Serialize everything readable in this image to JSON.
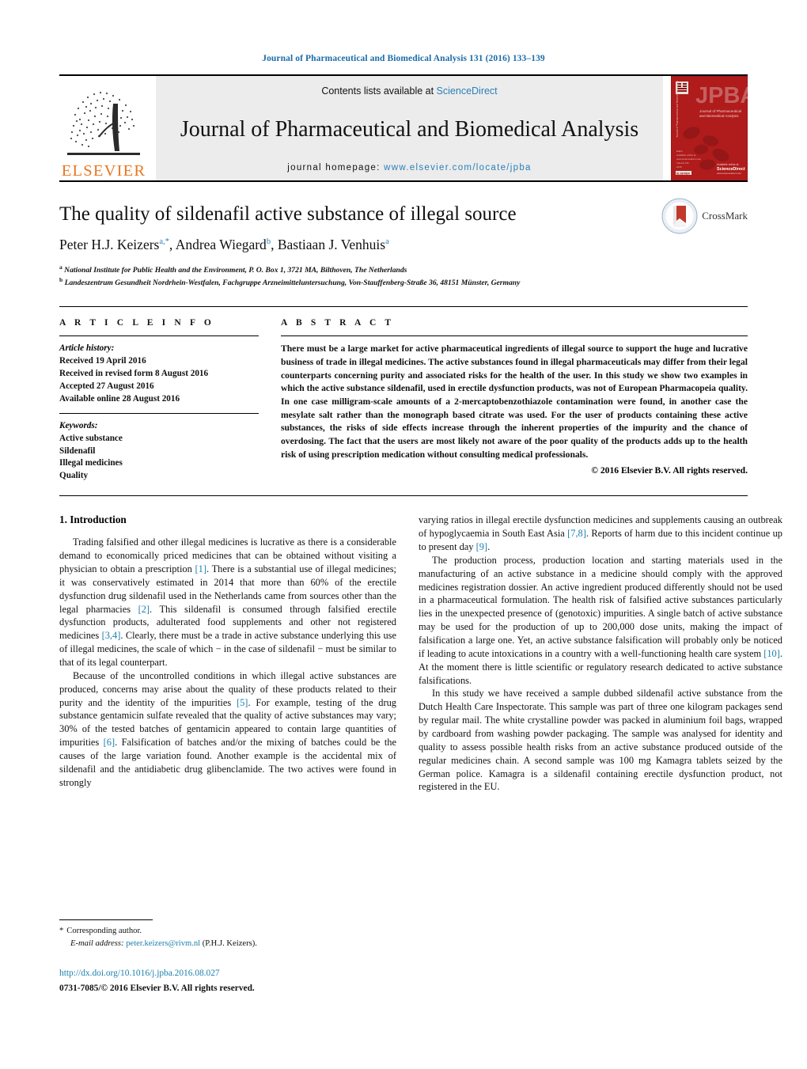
{
  "running_head": "Journal of Pharmaceutical and Biomedical Analysis 131 (2016) 133–139",
  "masthead": {
    "publisher_name": "ELSEVIER",
    "contents_prefix": "Contents lists available at ",
    "contents_link": "ScienceDirect",
    "journal_title": "Journal of Pharmaceutical and Biomedical Analysis",
    "homepage_prefix": "journal homepage: ",
    "homepage_url": "www.elsevier.com/locate/jpba",
    "cover": {
      "acronym": "JPBA",
      "subtitle_1": "Journal of Pharmaceutical",
      "subtitle_2": "and Biomedical Analysis",
      "footer_brand": "ScienceDirect"
    }
  },
  "article": {
    "title": "The quality of sildenafil active substance of illegal source",
    "authors": [
      {
        "name": "Peter H.J. Keizers",
        "marks": "a,*"
      },
      {
        "name": "Andrea Wiegard",
        "marks": "b"
      },
      {
        "name": "Bastiaan J. Venhuis",
        "marks": "a"
      }
    ],
    "authors_line": "Peter H.J. Keizers",
    "affiliations": [
      {
        "mark": "a",
        "text": "National Institute for Public Health and the Environment, P. O. Box 1, 3721 MA, Bilthoven, The Netherlands"
      },
      {
        "mark": "b",
        "text": "Landeszentrum Gesundheit Nordrhein-Westfalen, Fachgruppe Arzneimitteluntersuchung, Von-Stauffenberg-Straße 36, 48151 Münster, Germany"
      }
    ],
    "crossmark_label": "CrossMark"
  },
  "article_info": {
    "heading": "A R T I C L E    I N F O",
    "history_label": "Article history:",
    "history": [
      "Received 19 April 2016",
      "Received in revised form 8 August 2016",
      "Accepted 27 August 2016",
      "Available online 28 August 2016"
    ],
    "keywords_label": "Keywords:",
    "keywords": [
      "Active substance",
      "Sildenafil",
      "Illegal medicines",
      "Quality"
    ]
  },
  "abstract": {
    "heading": "A B S T R A C T",
    "body": "There must be a large market for active pharmaceutical ingredients of illegal source to support the huge and lucrative business of trade in illegal medicines. The active substances found in illegal pharmaceuticals may differ from their legal counterparts concerning purity and associated risks for the health of the user. In this study we show two examples in which the active substance sildenafil, used in erectile dysfunction products, was not of European Pharmacopeia quality. In one case milligram-scale amounts of a 2-mercaptobenzothiazole contamination were found, in another case the mesylate salt rather than the monograph based citrate was used. For the user of products containing these active substances, the risks of side effects increase through the inherent properties of the impurity and the chance of overdosing. The fact that the users are most likely not aware of the poor quality of the products adds up to the health risk of using prescription medication without consulting medical professionals.",
    "copyright": "© 2016 Elsevier B.V. All rights reserved."
  },
  "body": {
    "section_heading": "1.  Introduction",
    "left_paragraphs": [
      "Trading falsified and other illegal medicines is lucrative as there is a considerable demand to economically priced medicines that can be obtained without visiting a physician to obtain a prescription [1]. There is a substantial use of illegal medicines; it was conservatively estimated in 2014 that more than 60% of the erectile dysfunction drug sildenafil used in the Netherlands came from sources other than the legal pharmacies [2]. This sildenafil is consumed through falsified erectile dysfunction products, adulterated food supplements and other not registered medicines [3,4]. Clearly, there must be a trade in active substance underlying this use of illegal medicines, the scale of which − in the case of sildenafil − must be similar to that of its legal counterpart.",
      "Because of the uncontrolled conditions in which illegal active substances are produced, concerns may arise about the quality of these products related to their purity and the identity of the impurities [5]. For example, testing of the drug substance gentamicin sulfate revealed that the quality of active substances may vary; 30% of the tested batches of gentamicin appeared to contain large quantities of impurities [6]. Falsification of batches and/or the mixing of batches could be the causes of the large variation found. Another example is the accidental mix of sildenafil and the antidiabetic drug glibenclamide. The two actives were found in strongly"
    ],
    "right_paragraphs": [
      "varying ratios in illegal erectile dysfunction medicines and supplements causing an outbreak of hypoglycaemia in South East Asia [7,8]. Reports of harm due to this incident continue up to present day [9].",
      "The production process, production location and starting materials used in the manufacturing of an active substance in a medicine should comply with the approved medicines registration dossier. An active ingredient produced differently should not be used in a pharmaceutical formulation. The health risk of falsified active substances particularly lies in the unexpected presence of (genotoxic) impurities. A single batch of active substance may be used for the production of up to 200,000 dose units, making the impact of falsification a large one. Yet, an active substance falsification will probably only be noticed if leading to acute intoxications in a country with a well-functioning health care system [10]. At the moment there is little scientific or regulatory research dedicated to active substance falsifications.",
      "In this study we have received a sample dubbed sildenafil active substance from the Dutch Health Care Inspectorate. This sample was part of three one kilogram packages send by regular mail. The white crystalline powder was packed in aluminium foil bags, wrapped by cardboard from washing powder packaging. The sample was analysed for identity and quality to assess possible health risks from an active substance produced outside of the regular medicines chain. A second sample was 100 mg Kamagra tablets seized by the German police. Kamagra is a sildenafil containing erectile dysfunction product, not registered in the EU."
    ]
  },
  "footer": {
    "corresponding_star": "*",
    "corresponding_label": "Corresponding author.",
    "email_label": "E-mail address:",
    "email": "peter.keizers@rivm.nl",
    "email_owner": "(P.H.J. Keizers).",
    "doi": "http://dx.doi.org/10.1016/j.jpba.2016.08.027",
    "issn_line": "0731-7085/© 2016 Elsevier B.V. All rights reserved."
  },
  "colors": {
    "link_blue": "#1b7fad",
    "header_blue": "#1b6ca8",
    "elsevier_orange": "#E87722",
    "cover_red": "#b01b1b",
    "band_gray": "#ececec"
  }
}
